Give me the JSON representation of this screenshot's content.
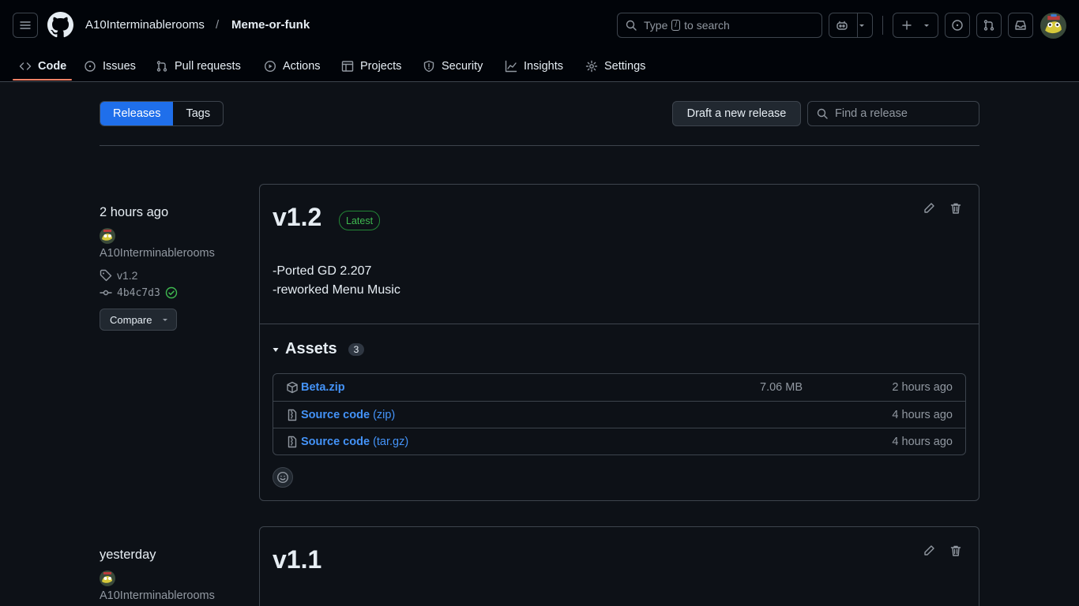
{
  "header": {
    "owner": "A10Interminablerooms",
    "separator": "/",
    "repo": "Meme-or-funk",
    "search": {
      "pre": "Type",
      "key": "/",
      "post": "to search"
    }
  },
  "tabs": [
    {
      "label": "Code",
      "icon": "code-icon"
    },
    {
      "label": "Issues",
      "icon": "issue-icon"
    },
    {
      "label": "Pull requests",
      "icon": "pull-request-icon"
    },
    {
      "label": "Actions",
      "icon": "play-icon"
    },
    {
      "label": "Projects",
      "icon": "table-icon"
    },
    {
      "label": "Security",
      "icon": "shield-icon"
    },
    {
      "label": "Insights",
      "icon": "graph-icon"
    },
    {
      "label": "Settings",
      "icon": "gear-icon"
    }
  ],
  "subheader": {
    "releases": "Releases",
    "tags": "Tags",
    "draft": "Draft a new release",
    "find_placeholder": "Find a release"
  },
  "releases": [
    {
      "time": "2 hours ago",
      "author": "A10Interminablerooms",
      "tag": "v1.2",
      "commit": "4b4c7d3",
      "compare": "Compare",
      "title": "v1.2",
      "badge": "Latest",
      "notes": [
        "-Ported GD 2.207",
        "-reworked Menu Music"
      ],
      "assets_label": "Assets",
      "assets_count": "3",
      "assets": [
        {
          "name": "Beta.zip",
          "suffix": "",
          "size": "7.06 MB",
          "date": "2 hours ago"
        },
        {
          "name": "Source code",
          "suffix": "(zip)",
          "size": "",
          "date": "4 hours ago"
        },
        {
          "name": "Source code",
          "suffix": "(tar.gz)",
          "size": "",
          "date": "4 hours ago"
        }
      ]
    },
    {
      "time": "yesterday",
      "author": "A10Interminablerooms",
      "title": "v1.1"
    }
  ]
}
